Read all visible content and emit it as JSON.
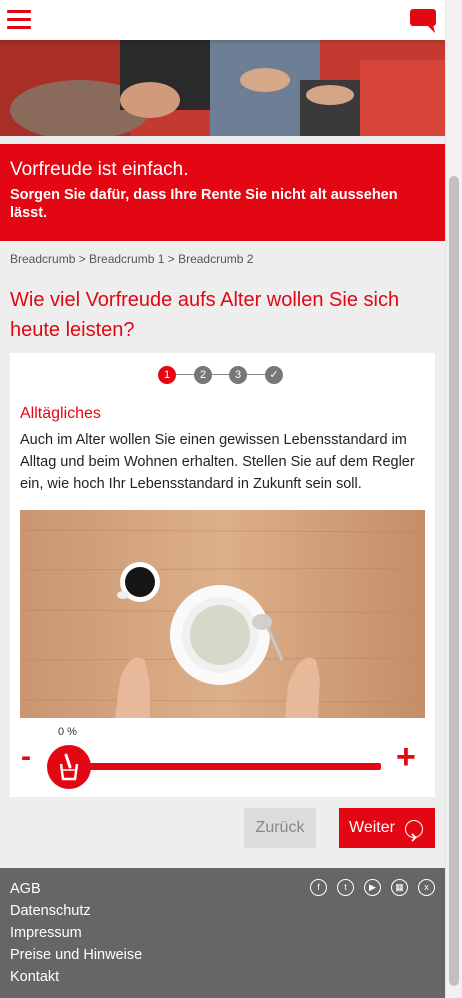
{
  "colors": {
    "brand_red": "#e30613",
    "footer_gray": "#666666",
    "background": "#eeeeee"
  },
  "header": {
    "menu_icon": "hamburger-menu-icon",
    "chat_icon": "chat-bubble-icon"
  },
  "banner": {
    "title": "Vorfreude ist einfach.",
    "subtitle": "Sorgen Sie dafür, dass Ihre Rente Sie nicht alt aussehen lässt."
  },
  "breadcrumb": "Breadcrumb > Breadcrumb 1 > Breadcrumb 2",
  "headline": "Wie viel Vorfreude aufs Alter wollen Sie sich heute leisten?",
  "stepper": {
    "steps": [
      "1",
      "2",
      "3",
      "✓"
    ],
    "active_step": 1
  },
  "section": {
    "title": "Alltägliches",
    "text": "Auch im Alter wollen Sie einen gewissen Lebensstandard im Alltag und beim Wohnen erhalten. Stellen Sie auf dem Regler ein, wie hoch Ihr Lebensstandard in Zukunft sein soll."
  },
  "slider": {
    "minus_label": "-",
    "plus_label": "+",
    "value_label": "0 %",
    "value_percent": 0
  },
  "buttons": {
    "back": "Zurück",
    "next": "Weiter"
  },
  "footer": {
    "links": [
      "AGB",
      "Datenschutz",
      "Impressum",
      "Preise und Hinweise",
      "Kontakt"
    ],
    "social_icons": [
      "facebook-icon",
      "twitter-icon",
      "youtube-icon",
      "calendar-icon",
      "xing-icon"
    ]
  }
}
